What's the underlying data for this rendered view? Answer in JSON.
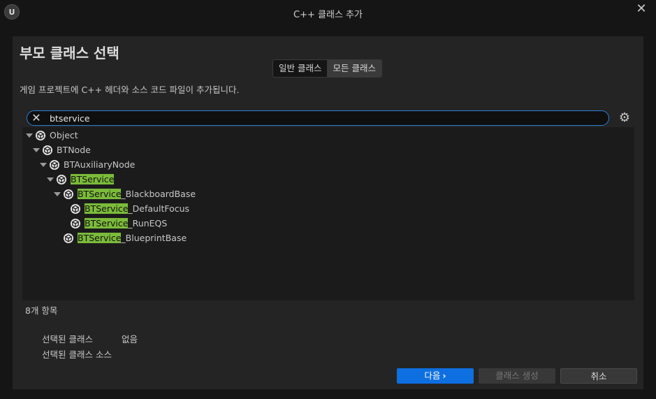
{
  "window": {
    "title": "C++ 클래스 추가",
    "logo_text": "U"
  },
  "panel": {
    "heading": "부모 클래스 선택",
    "tabs": [
      {
        "label": "일반 클래스",
        "active": false
      },
      {
        "label": "모든 클래스",
        "active": true
      }
    ],
    "description": "게임 프로젝트에 C++ 헤더와 소스 코드 파일이 추가됩니다."
  },
  "search": {
    "value": "btservice",
    "clear_icon": "close-icon",
    "settings_icon": "gear-icon"
  },
  "tree": {
    "items": [
      {
        "pre": "",
        "match": "",
        "post": "Object"
      },
      {
        "pre": "",
        "match": "",
        "post": "BTNode"
      },
      {
        "pre": "",
        "match": "",
        "post": "BTAuxiliaryNode"
      },
      {
        "pre": "",
        "match": "BTService",
        "post": ""
      },
      {
        "pre": "",
        "match": "BTService",
        "post": "_BlackboardBase"
      },
      {
        "pre": "",
        "match": "BTService",
        "post": "_DefaultFocus"
      },
      {
        "pre": "",
        "match": "BTService",
        "post": "_RunEQS"
      },
      {
        "pre": "",
        "match": "BTService",
        "post": "_BlueprintBase"
      }
    ],
    "count_label": "8개 항목"
  },
  "selection": {
    "class_label": "선택된 클래스",
    "class_value": "없음",
    "source_label": "선택된 클래스 소스"
  },
  "buttons": {
    "next": "다음",
    "next_icon": "chevron-right-icon",
    "create": "클래스 생성",
    "cancel": "취소"
  },
  "colors": {
    "highlight": "#7bbb3a",
    "accent": "#0e6fe0",
    "search_border": "#2b7fd6"
  }
}
